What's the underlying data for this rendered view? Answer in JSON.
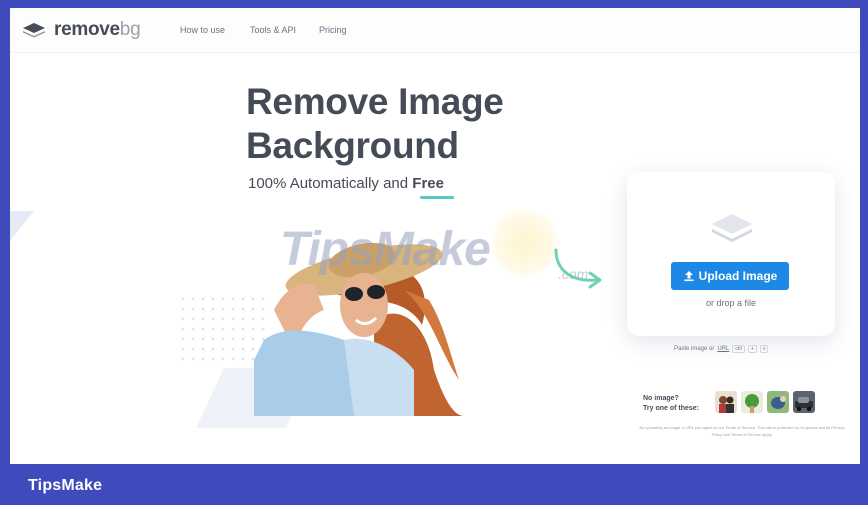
{
  "nav": {
    "logo_remove": "remove",
    "logo_bg": "bg",
    "links": [
      "How to use",
      "Tools & API",
      "Pricing"
    ]
  },
  "hero": {
    "title_line1": "Remove Image",
    "title_line2": "Background",
    "subtitle_prefix": "100% Automatically and ",
    "subtitle_emphasis": "Free"
  },
  "watermark": {
    "text": "TipsMake",
    "suffix": ".com"
  },
  "upload": {
    "button_label": "Upload Image",
    "drop_text": "or drop a file",
    "paste_text": "Paste image or",
    "paste_link": "URL",
    "kbd_ctrl": "ctrl",
    "kbd_plus": "+",
    "kbd_v": "v"
  },
  "samples": {
    "line1": "No image?",
    "line2": "Try one of these:"
  },
  "legal": "By uploading an image or URL you agree to our Terms of Service. This site is protected by hCaptcha and its Privacy Policy and Terms of Service apply.",
  "footer": {
    "brand": "TipsMake"
  },
  "colors": {
    "frame": "#3f4bbd",
    "accent": "#1e88e5",
    "text": "#454c57",
    "underline": "#59c8c1"
  }
}
